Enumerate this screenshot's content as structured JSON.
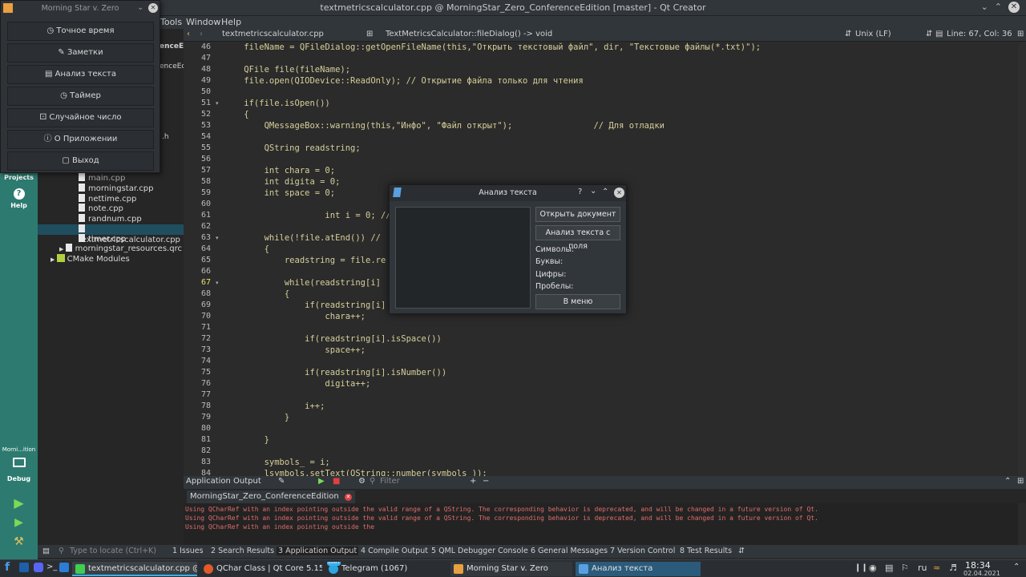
{
  "window": {
    "title": "textmetricscalculator.cpp @ MorningStar_Zero_ConferenceEdition [master] - Qt Creator"
  },
  "menu": {
    "tools": "Tools",
    "window": "Window",
    "help": "Help"
  },
  "modebar": {
    "projects": "Projects",
    "help": "Help",
    "kit": "Morni...ition",
    "debug": "Debug"
  },
  "project_tree": {
    "partial_root": "enceE",
    "partial_item": "enceEd",
    "partial_h": ".h",
    "files": [
      "main.cpp",
      "morningstar.cpp",
      "nettime.cpp",
      "note.cpp",
      "randnum.cpp",
      "textmetricscalculator.cpp",
      "timer.cpp"
    ],
    "resources": "morningstar_resources.qrc",
    "cmake": "CMake Modules"
  },
  "editor_header": {
    "file": "textmetricscalculator.cpp",
    "symbol": "TextMetricsCalculator::fileDialog() -> void",
    "line_endings": "Unix (LF)",
    "position": "Line: 67, Col: 36"
  },
  "code": {
    "line_numbers": [
      "46",
      "47",
      "48",
      "49",
      "50",
      "51",
      "52",
      "53",
      "54",
      "55",
      "56",
      "57",
      "58",
      "59",
      "60",
      "61",
      "62",
      "63",
      "64",
      "65",
      "66",
      "67",
      "68",
      "69",
      "70",
      "71",
      "72",
      "73",
      "74",
      "75",
      "76",
      "77",
      "78",
      "79",
      "80",
      "81",
      "82",
      "83",
      "84"
    ],
    "lines": [
      "    fileName = QFileDialog::getOpenFileName(this,\"Открыть текстовый файл\", dir, \"Текстовые файлы(*.txt)\");",
      "",
      "    QFile file(fileName);",
      "    file.open(QIODevice::ReadOnly); // Открытие файла только для чтения",
      "",
      "    if(file.isOpen())",
      "    {",
      "        QMessageBox::warning(this,\"Инфо\", \"Файл открыт\");                // Для отладки",
      "",
      "        QString readstring;",
      "",
      "        int chara = 0;",
      "        int digita = 0;",
      "        int space = 0;",
      "",
      "                    int i = 0; //",
      "",
      "        while(!file.atEnd()) //",
      "        {",
      "            readstring = file.re",
      "",
      "            while(readstring[i]",
      "            {",
      "                if(readstring[i]",
      "                    chara++;",
      "",
      "                if(readstring[i].isSpace())",
      "                    space++;",
      "",
      "                if(readstring[i].isNumber())",
      "                    digita++;",
      "",
      "                i++;",
      "            }",
      "",
      "        }",
      "",
      "        symbols_ = i;",
      "        lsymbols.setText(QString::number(symbols_));"
    ]
  },
  "output": {
    "title": "Application Output",
    "filter_placeholder": "Filter",
    "tab": "MorningStar_Zero_ConferenceEdition",
    "lines": [
      "Using QCharRef with an index pointing outside the valid range of a QString. The corresponding behavior is deprecated, and will be changed in a future version of Qt.",
      "Using QCharRef with an index pointing outside the valid range of a QString. The corresponding behavior is deprecated, and will be changed in a future version of Qt.",
      "Using QCharRef with an index pointing outside the"
    ]
  },
  "statusbar": {
    "locate_placeholder": "Type to locate (Ctrl+K)",
    "tabs": [
      "1 Issues",
      "2 Search Results",
      "3 Application Output",
      "4 Compile Output",
      "5 QML Debugger Console",
      "6 General Messages",
      "7 Version Control",
      "8 Test Results"
    ]
  },
  "taskbar": {
    "tasks": [
      "textmetricscalculator.cpp @ ...",
      "QChar Class | Qt Core 5.15.3...",
      "Telegram (1067)",
      "Morning Star v. Zero",
      "Анализ текста"
    ],
    "badge": "1067",
    "lang": "ru",
    "time": "18:34",
    "date": "02.04.2021"
  },
  "app_menu": {
    "title": "Morning Star v. Zero",
    "items": [
      "Точное время",
      "Заметки",
      "Анализ текста",
      "Таймер",
      "Случайное число",
      "О Приложении",
      "Выход"
    ]
  },
  "dialog": {
    "title": "Анализ текста",
    "open_button": "Открыть документ",
    "analyze_button": "Анализ текста с поля",
    "symbols": "Символы:",
    "letters": "Буквы:",
    "digits": "Цифры:",
    "spaces": "Пробелы:",
    "menu_button": "В меню",
    "help": "?"
  },
  "colors": {
    "accent": "#2d7b70",
    "error": "#e06c6c",
    "selection": "#1f4e5f"
  }
}
